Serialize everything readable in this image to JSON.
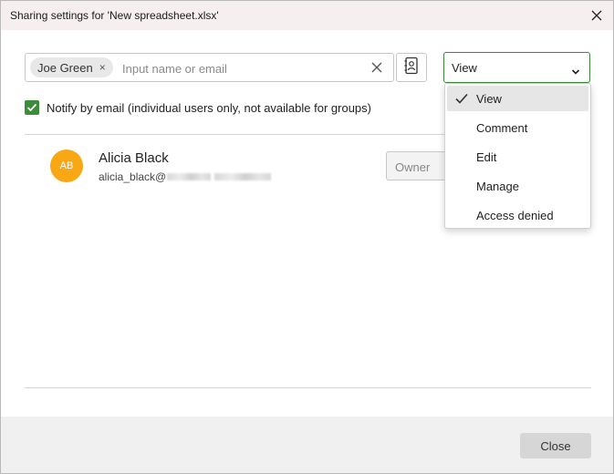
{
  "dialog": {
    "title": "Sharing settings for 'New spreadsheet.xlsx'"
  },
  "invite": {
    "chip_label": "Joe Green",
    "chip_remove_glyph": "×",
    "placeholder": "Input name or email",
    "value": "",
    "clear_icon": "close-icon",
    "address_book_icon": "address-book-icon"
  },
  "access_select": {
    "value": "View",
    "icon": "chevron-down-icon",
    "accent_color": "#3a8a38",
    "options": [
      {
        "label": "View",
        "selected": true
      },
      {
        "label": "Comment",
        "selected": false
      },
      {
        "label": "Edit",
        "selected": false
      },
      {
        "label": "Manage",
        "selected": false
      },
      {
        "label": "Access denied",
        "selected": false
      }
    ]
  },
  "notify": {
    "checked": true,
    "label": "Notify by email (individual users only, not available for groups)"
  },
  "users": [
    {
      "initials": "AB",
      "avatar_color": "#f7a814",
      "name": "Alicia Black",
      "email_visible": "alicia_black@",
      "role": "Owner"
    }
  ],
  "footer": {
    "close_label": "Close"
  }
}
